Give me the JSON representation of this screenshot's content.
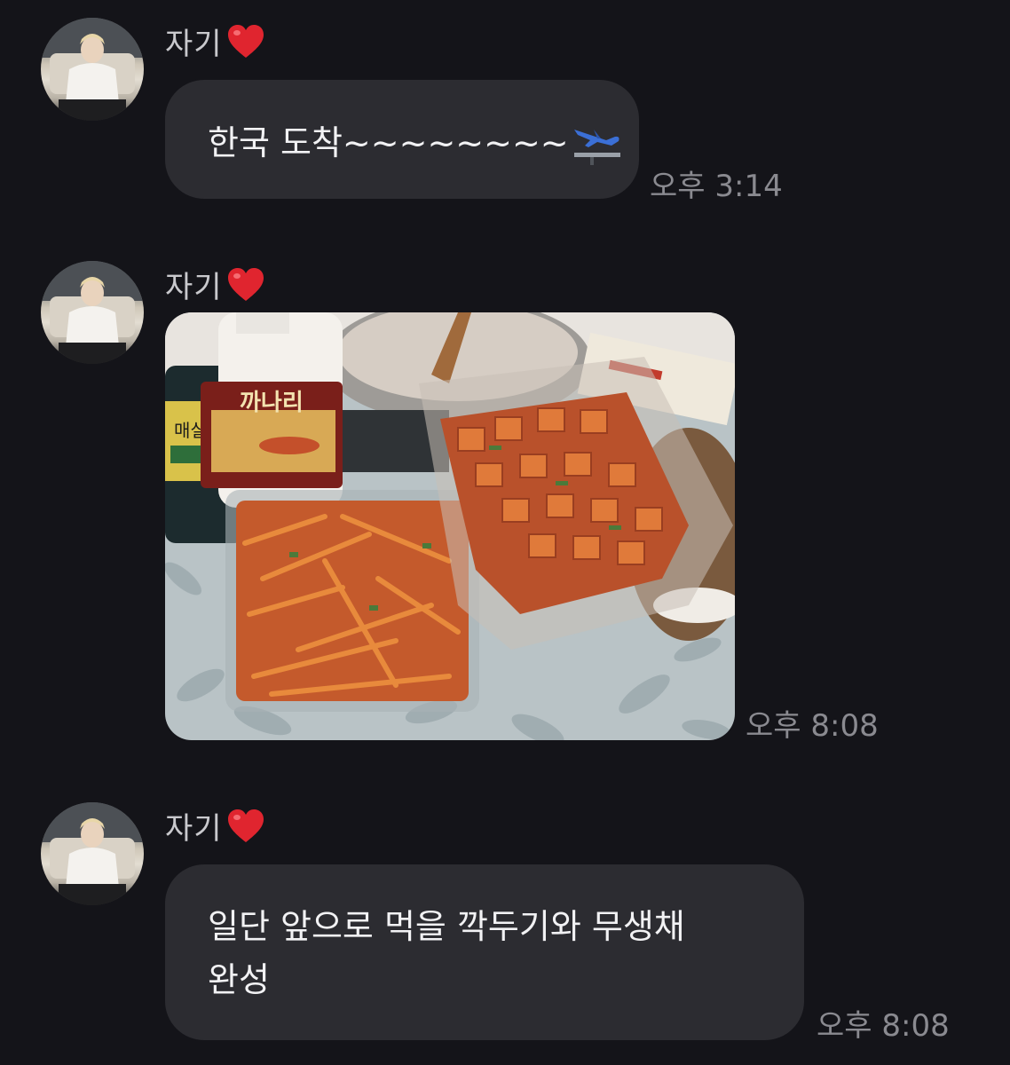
{
  "messages": [
    {
      "sender": "자기",
      "sender_emoji": "heart-icon",
      "text": "한국 도착~~~~~~~~",
      "attachment_emoji": "airplane-arriving-icon",
      "time": "오후 3:14"
    },
    {
      "sender": "자기",
      "sender_emoji": "heart-icon",
      "image": {
        "kind": "photo",
        "bottle_label_large": "까나리",
        "bottle_label_small": "매실원"
      },
      "time": "오후 8:08"
    },
    {
      "sender": "자기",
      "sender_emoji": "heart-icon",
      "text_line1": "일단 앞으로 먹을 깍두기와 무생채",
      "text_line2": "완성",
      "time": "오후 8:08"
    }
  ],
  "colors": {
    "background": "#141419",
    "bubble": "#2c2c31",
    "heart": "#e0252f",
    "timestamp": "#8a8a90"
  }
}
